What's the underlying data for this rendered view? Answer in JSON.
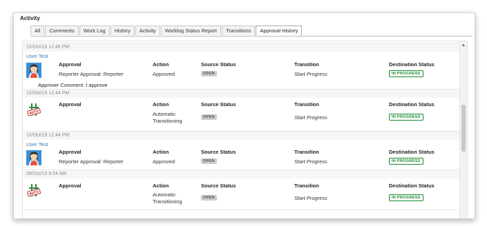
{
  "panel": {
    "title": "Activity"
  },
  "tabs": [
    {
      "label": "All"
    },
    {
      "label": "Comments"
    },
    {
      "label": "Work Log"
    },
    {
      "label": "History"
    },
    {
      "label": "Activity"
    },
    {
      "label": "Worklog Status Report"
    },
    {
      "label": "Transitions"
    },
    {
      "label": "Approval History"
    }
  ],
  "active_tab": "Approval History",
  "headers": {
    "approval": "Approval",
    "action": "Action",
    "source": "Source Status",
    "transition": "Transition",
    "destination": "Destination Status"
  },
  "entries": [
    {
      "timestamp": "12/Oct/15 12:45 PM",
      "user": "User Test",
      "avatar": "user-avatar-icon",
      "approval": "Reporter Approval: Reporter",
      "action": "Approved",
      "source_status": "OPEN",
      "transition": "Start Progress",
      "destination_status": "IN PROGRESS",
      "comment": "Approver Comment: I approve"
    },
    {
      "timestamp": "12/Oct/15 12:44 PM",
      "user": "",
      "avatar": "auto-stamp-icon",
      "approval": "",
      "action_line1": "Automatic",
      "action_line2": "Transitioning",
      "source_status": "OPEN",
      "transition": "Start Progress",
      "destination_status": "IN PROGRESS"
    },
    {
      "timestamp": "12/Oct/15 12:44 PM",
      "user": "User Test",
      "avatar": "user-avatar-icon",
      "approval": "Reporter Approval: Reporter",
      "action": "Approved",
      "source_status": "OPEN",
      "transition": "Start Progress",
      "destination_status": "IN PROGRESS"
    },
    {
      "timestamp": "09/Oct/15 9:54 AM",
      "user": "",
      "avatar": "auto-stamp-icon",
      "approval": "",
      "action_line1": "Automatic",
      "action_line2": "Transitioning",
      "source_status": "OPEN",
      "transition": "Start Progress",
      "destination_status": "IN PROGRESS"
    }
  ],
  "colors": {
    "link": "#3572b0",
    "in_progress": "#14892c",
    "open_lozenge": "#cccccc"
  }
}
